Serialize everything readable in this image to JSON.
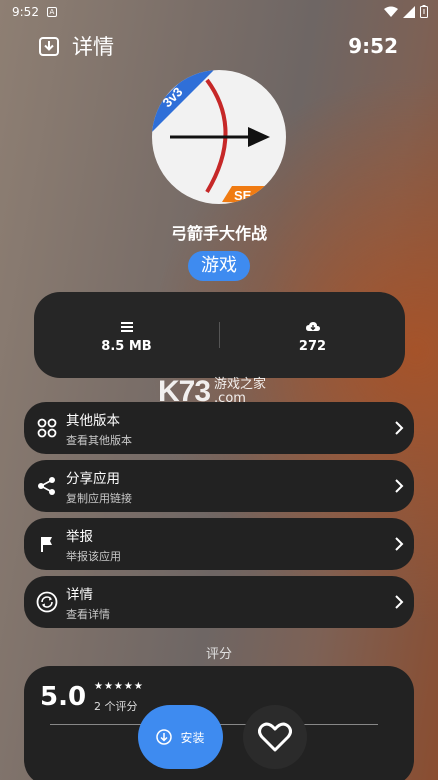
{
  "status_bar": {
    "time": "9:52",
    "notif_glyph": "A"
  },
  "app_bar": {
    "title": "详情",
    "clock": "9:52"
  },
  "app": {
    "name": "弓箭手大作战",
    "category": "游戏",
    "logo_badge_top": "3v3",
    "logo_badge_bottom": "SE"
  },
  "stats": {
    "size": "8.5 MB",
    "downloads": "272"
  },
  "watermark": {
    "brand": "K73",
    "line1": "游戏之家",
    "line2": ".com"
  },
  "menu": [
    {
      "title": "其他版本",
      "subtitle": "查看其他版本",
      "icon": "apps-grid-icon"
    },
    {
      "title": "分享应用",
      "subtitle": "复制应用链接",
      "icon": "share-icon"
    },
    {
      "title": "举报",
      "subtitle": "举报该应用",
      "icon": "flag-icon"
    },
    {
      "title": "详情",
      "subtitle": "查看详情",
      "icon": "sync-icon"
    }
  ],
  "rating_section": {
    "label": "评分",
    "score": "5.0",
    "stars": "★★★★★",
    "count": "2 个评分"
  },
  "actions": {
    "install": "安装"
  }
}
